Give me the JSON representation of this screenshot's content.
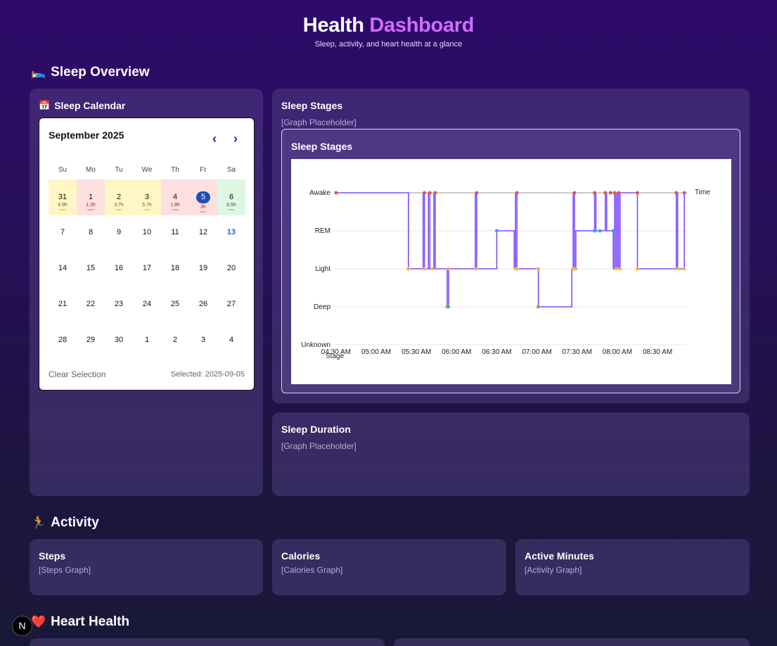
{
  "header": {
    "title_main": "Health",
    "title_accent": "Dashboard",
    "subtitle": "Sleep, activity, and heart health at a glance"
  },
  "sections": {
    "sleep": {
      "emoji": "🛌",
      "title": "Sleep Overview"
    },
    "activity": {
      "emoji": "🏃",
      "title": "Activity"
    },
    "heart": {
      "emoji": "❤️",
      "title": "Heart Health"
    }
  },
  "calendar_card": {
    "emoji": "📅",
    "title": "Sleep Calendar",
    "month_label": "September 2025",
    "prev_label": "‹",
    "next_label": "›",
    "weekdays": [
      "Su",
      "Mo",
      "Tu",
      "We",
      "Th",
      "Fr",
      "Sa"
    ],
    "days": [
      {
        "n": "31",
        "hrs": "4.9h",
        "c": "yellow"
      },
      {
        "n": "1",
        "hrs": "1.2h",
        "c": "red"
      },
      {
        "n": "2",
        "hrs": "3.7h",
        "c": "yellow"
      },
      {
        "n": "3",
        "hrs": "5.7h",
        "c": "yellow"
      },
      {
        "n": "4",
        "hrs": "1.8h",
        "c": "red"
      },
      {
        "n": "5",
        "hrs": "3h",
        "c": "red",
        "selected": true
      },
      {
        "n": "6",
        "hrs": "6.5h",
        "c": "green"
      },
      {
        "n": "7"
      },
      {
        "n": "8"
      },
      {
        "n": "9"
      },
      {
        "n": "10"
      },
      {
        "n": "11"
      },
      {
        "n": "12"
      },
      {
        "n": "13",
        "today": true
      },
      {
        "n": "14"
      },
      {
        "n": "15"
      },
      {
        "n": "16"
      },
      {
        "n": "17"
      },
      {
        "n": "18"
      },
      {
        "n": "19"
      },
      {
        "n": "20"
      },
      {
        "n": "21"
      },
      {
        "n": "22"
      },
      {
        "n": "23"
      },
      {
        "n": "24"
      },
      {
        "n": "25"
      },
      {
        "n": "26"
      },
      {
        "n": "27"
      },
      {
        "n": "28"
      },
      {
        "n": "29"
      },
      {
        "n": "30"
      },
      {
        "n": "1"
      },
      {
        "n": "2"
      },
      {
        "n": "3"
      },
      {
        "n": "4"
      }
    ],
    "clear_label": "Clear Selection",
    "selected_label": "Selected: 2025-09-05"
  },
  "sleep_stages_card": {
    "title": "Sleep Stages",
    "placeholder": "[Graph Placeholder]",
    "inner_title": "Sleep Stages"
  },
  "sleep_duration_card": {
    "title": "Sleep Duration",
    "placeholder": "[Graph Placeholder]"
  },
  "activity_cards": [
    {
      "title": "Steps",
      "placeholder": "[Steps Graph]"
    },
    {
      "title": "Calories",
      "placeholder": "[Calories Graph]"
    },
    {
      "title": "Active Minutes",
      "placeholder": "[Activity Graph]"
    }
  ],
  "next_badge": "N",
  "colors": {
    "accent": "#d26bff",
    "line": "#7c4dff",
    "awake": "#e05555",
    "rem": "#3b9cf0",
    "light": "#f5b544",
    "deep": "#5cc43f"
  },
  "chart_data": {
    "type": "line",
    "title": "",
    "xlabel": "Time",
    "ylabel": "Stage",
    "stages": [
      "Unknown",
      "Deep",
      "Light",
      "REM",
      "Awake"
    ],
    "x_ticks": [
      "04:30 AM",
      "05:00 AM",
      "05:30 AM",
      "06:00 AM",
      "06:30 AM",
      "07:00 AM",
      "07:30 AM",
      "08:00 AM",
      "08:30 AM"
    ],
    "xlim_minutes_after_0430": [
      -1,
      262
    ],
    "series": [
      {
        "points": [
          [
            0,
            "Awake"
          ],
          [
            54,
            "Awake"
          ],
          [
            54,
            "Light"
          ],
          [
            65,
            "Light"
          ],
          [
            65,
            "Awake"
          ],
          [
            66,
            "Awake"
          ],
          [
            66,
            "Light"
          ],
          [
            69,
            "Light"
          ],
          [
            69,
            "Awake"
          ],
          [
            70,
            "Awake"
          ],
          [
            70,
            "Light"
          ],
          [
            73,
            "Light"
          ],
          [
            73,
            "Awake"
          ],
          [
            74,
            "Awake"
          ],
          [
            74,
            "Light"
          ],
          [
            83,
            "Light"
          ],
          [
            83,
            "Deep"
          ],
          [
            84,
            "Deep"
          ],
          [
            84,
            "Light"
          ],
          [
            104,
            "Light"
          ],
          [
            104,
            "Awake"
          ],
          [
            105,
            "Awake"
          ],
          [
            105,
            "Light"
          ],
          [
            120,
            "Light"
          ],
          [
            120,
            "REM"
          ],
          [
            133,
            "REM"
          ],
          [
            133,
            "Light"
          ],
          [
            134,
            "Light"
          ],
          [
            134,
            "Awake"
          ],
          [
            135,
            "Awake"
          ],
          [
            135,
            "Light"
          ],
          [
            151,
            "Light"
          ],
          [
            151,
            "Deep"
          ],
          [
            176,
            "Deep"
          ],
          [
            176,
            "Light"
          ],
          [
            177,
            "Light"
          ],
          [
            177,
            "Awake"
          ],
          [
            178,
            "Awake"
          ],
          [
            178,
            "Light"
          ],
          [
            179,
            "Light"
          ],
          [
            179,
            "REM"
          ],
          [
            193,
            "REM"
          ],
          [
            193,
            "Awake"
          ],
          [
            194,
            "Awake"
          ],
          [
            194,
            "REM"
          ],
          [
            201,
            "REM"
          ],
          [
            201,
            "Awake"
          ],
          [
            202,
            "Awake"
          ],
          [
            202,
            "REM"
          ],
          [
            207,
            "REM"
          ],
          [
            207,
            "Light"
          ],
          [
            208,
            "Light"
          ],
          [
            208,
            "Awake"
          ],
          [
            209,
            "Awake"
          ],
          [
            209,
            "Light"
          ],
          [
            210,
            "Light"
          ],
          [
            210,
            "Awake"
          ],
          [
            211,
            "Awake"
          ],
          [
            211,
            "Light"
          ],
          [
            212,
            "Light"
          ],
          [
            212,
            "Awake"
          ],
          [
            225,
            "Awake"
          ],
          [
            225,
            "Light"
          ],
          [
            254,
            "Light"
          ],
          [
            254,
            "Awake"
          ],
          [
            255,
            "Awake"
          ],
          [
            255,
            "Light"
          ],
          [
            260,
            "Light"
          ],
          [
            260,
            "Awake"
          ]
        ]
      }
    ],
    "markers": [
      [
        0,
        "Awake"
      ],
      [
        66,
        "Awake"
      ],
      [
        70,
        "Awake"
      ],
      [
        74,
        "Awake"
      ],
      [
        105,
        "Awake"
      ],
      [
        135,
        "Awake"
      ],
      [
        178,
        "Awake"
      ],
      [
        193,
        "Awake"
      ],
      [
        201,
        "Awake"
      ],
      [
        205,
        "Awake"
      ],
      [
        208,
        "Awake"
      ],
      [
        211,
        "Awake"
      ],
      [
        225,
        "Awake"
      ],
      [
        254,
        "Awake"
      ],
      [
        260,
        "Awake"
      ],
      [
        120,
        "REM"
      ],
      [
        193,
        "REM"
      ],
      [
        197,
        "REM"
      ],
      [
        207,
        "REM"
      ],
      [
        54,
        "Light"
      ],
      [
        66,
        "Light"
      ],
      [
        72,
        "Light"
      ],
      [
        84,
        "Light"
      ],
      [
        105,
        "Light"
      ],
      [
        134,
        "Light"
      ],
      [
        135,
        "Light"
      ],
      [
        151,
        "Light"
      ],
      [
        177,
        "Light"
      ],
      [
        179,
        "Light"
      ],
      [
        209,
        "Light"
      ],
      [
        212,
        "Light"
      ],
      [
        225,
        "Light"
      ],
      [
        255,
        "Light"
      ],
      [
        260,
        "Light"
      ],
      [
        83,
        "Deep"
      ],
      [
        84,
        "Deep"
      ],
      [
        151,
        "Deep"
      ]
    ],
    "grid": true,
    "legend": "none"
  }
}
